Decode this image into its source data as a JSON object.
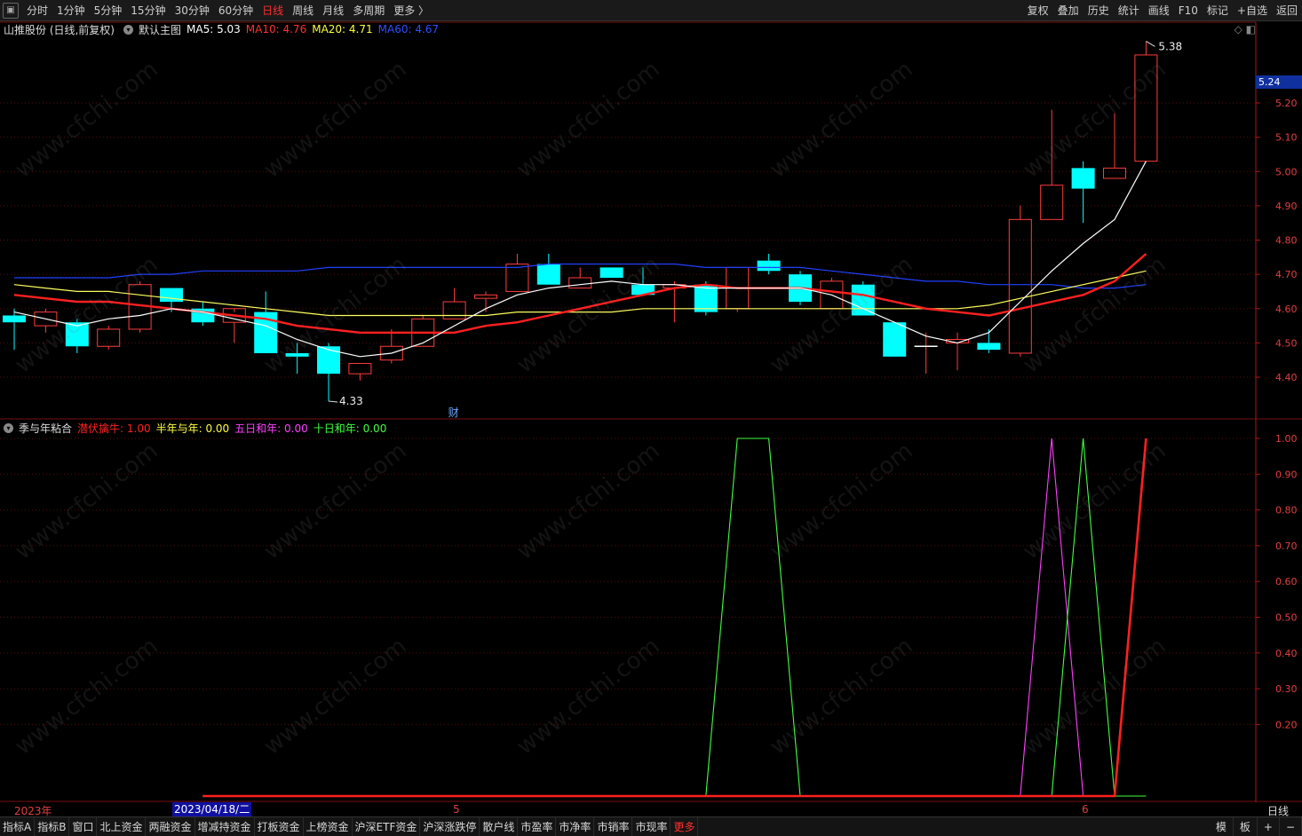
{
  "toolbar": {
    "periods": [
      "分时",
      "1分钟",
      "5分钟",
      "15分钟",
      "30分钟",
      "60分钟",
      "日线",
      "周线",
      "月线",
      "多周期",
      "更多 〉"
    ],
    "active_period": "日线",
    "right_buttons": [
      "复权",
      "叠加",
      "历史",
      "统计",
      "画线",
      "F10",
      "标记",
      "+自选",
      "返回"
    ]
  },
  "main_chart": {
    "stock": "山推股份 (日线,前复权)",
    "template": "默认主图",
    "ma5": "MA5: 5.03",
    "ma10": "MA10: 4.76",
    "ma20": "MA20: 4.71",
    "ma60": "MA60: 4.67",
    "current_price_tag": "5.24",
    "high_label": "5.38",
    "low_label": "4.33",
    "finance_marker": "财"
  },
  "sub_chart": {
    "name": "季与年粘合",
    "l1": "潜伏擒牛: 1.00",
    "l2": "半年与年: 0.00",
    "l3": "五日和年: 0.00",
    "l4": "十日和年: 0.00"
  },
  "date_axis": {
    "year": "2023年",
    "cursor": "2023/04/18/二",
    "m5": "5",
    "m6": "6",
    "period": "日线"
  },
  "bottom_tabs": [
    "指标A",
    "指标B",
    "窗口",
    "北上资金",
    "两融资金",
    "增减持资金",
    "打板资金",
    "上榜资金",
    "沪深ETF资金",
    "沪深涨跌停",
    "散户线",
    "市盈率",
    "市净率",
    "市销率",
    "市现率",
    "更多"
  ],
  "bottom_right": [
    "模",
    "板",
    "+",
    "−"
  ],
  "watermark": "www.cfchi.com",
  "colors": {
    "up": "#ff3c3c",
    "down": "#00ffff",
    "ma5": "#ffffff",
    "ma10": "#ff2020",
    "ma20": "#ffff60",
    "ma60": "#2040ff"
  },
  "chart_data": [
    {
      "type": "candlestick",
      "title": "山推股份 (日线,前复权)",
      "ylim": [
        4.33,
        5.38
      ],
      "y_ticks": [
        4.4,
        4.5,
        4.6,
        4.7,
        4.8,
        4.9,
        5.0,
        5.1,
        5.2
      ],
      "candles": [
        {
          "o": 4.58,
          "h": 4.6,
          "l": 4.48,
          "c": 4.56
        },
        {
          "o": 4.55,
          "h": 4.6,
          "l": 4.53,
          "c": 4.59
        },
        {
          "o": 4.56,
          "h": 4.57,
          "l": 4.47,
          "c": 4.49
        },
        {
          "o": 4.49,
          "h": 4.55,
          "l": 4.48,
          "c": 4.54
        },
        {
          "o": 4.54,
          "h": 4.68,
          "l": 4.53,
          "c": 4.67
        },
        {
          "o": 4.66,
          "h": 4.66,
          "l": 4.59,
          "c": 4.62
        },
        {
          "o": 4.6,
          "h": 4.62,
          "l": 4.55,
          "c": 4.56
        },
        {
          "o": 4.56,
          "h": 4.59,
          "l": 4.5,
          "c": 4.6
        },
        {
          "o": 4.59,
          "h": 4.65,
          "l": 4.47,
          "c": 4.47
        },
        {
          "o": 4.47,
          "h": 4.5,
          "l": 4.41,
          "c": 4.46
        },
        {
          "o": 4.49,
          "h": 4.5,
          "l": 4.33,
          "c": 4.41
        },
        {
          "o": 4.41,
          "h": 4.44,
          "l": 4.39,
          "c": 4.44
        },
        {
          "o": 4.45,
          "h": 4.54,
          "l": 4.44,
          "c": 4.49
        },
        {
          "o": 4.49,
          "h": 4.58,
          "l": 4.49,
          "c": 4.57
        },
        {
          "o": 4.57,
          "h": 4.66,
          "l": 4.57,
          "c": 4.62
        },
        {
          "o": 4.63,
          "h": 4.65,
          "l": 4.59,
          "c": 4.64
        },
        {
          "o": 4.65,
          "h": 4.76,
          "l": 4.65,
          "c": 4.73
        },
        {
          "o": 4.73,
          "h": 4.76,
          "l": 4.67,
          "c": 4.67
        },
        {
          "o": 4.66,
          "h": 4.72,
          "l": 4.66,
          "c": 4.69
        },
        {
          "o": 4.72,
          "h": 4.72,
          "l": 4.69,
          "c": 4.69
        },
        {
          "o": 4.67,
          "h": 4.72,
          "l": 4.64,
          "c": 4.64
        },
        {
          "o": 4.66,
          "h": 4.68,
          "l": 4.56,
          "c": 4.67
        },
        {
          "o": 4.67,
          "h": 4.68,
          "l": 4.58,
          "c": 4.59
        },
        {
          "o": 4.6,
          "h": 4.72,
          "l": 4.59,
          "c": 4.72
        },
        {
          "o": 4.74,
          "h": 4.76,
          "l": 4.7,
          "c": 4.71
        },
        {
          "o": 4.7,
          "h": 4.71,
          "l": 4.61,
          "c": 4.62
        },
        {
          "o": 4.6,
          "h": 4.69,
          "l": 4.6,
          "c": 4.68
        },
        {
          "o": 4.67,
          "h": 4.68,
          "l": 4.58,
          "c": 4.58
        },
        {
          "o": 4.56,
          "h": 4.56,
          "l": 4.46,
          "c": 4.46
        },
        {
          "o": 4.49,
          "h": 4.53,
          "l": 4.41,
          "c": 4.49
        },
        {
          "o": 4.5,
          "h": 4.53,
          "l": 4.42,
          "c": 4.51
        },
        {
          "o": 4.5,
          "h": 4.54,
          "l": 4.47,
          "c": 4.48
        },
        {
          "o": 4.47,
          "h": 4.9,
          "l": 4.46,
          "c": 4.86
        },
        {
          "o": 4.86,
          "h": 5.18,
          "l": 4.86,
          "c": 4.96
        },
        {
          "o": 5.01,
          "h": 5.03,
          "l": 4.85,
          "c": 4.95
        },
        {
          "o": 4.98,
          "h": 5.17,
          "l": 4.98,
          "c": 5.01
        },
        {
          "o": 5.03,
          "h": 5.38,
          "l": 5.03,
          "c": 5.34
        }
      ],
      "ma5": [
        4.59,
        4.57,
        4.55,
        4.57,
        4.58,
        4.6,
        4.59,
        4.57,
        4.55,
        4.51,
        4.48,
        4.46,
        4.47,
        4.5,
        4.55,
        4.6,
        4.64,
        4.66,
        4.67,
        4.68,
        4.67,
        4.67,
        4.66,
        4.66,
        4.66,
        4.66,
        4.64,
        4.6,
        4.56,
        4.52,
        4.5,
        4.53,
        4.62,
        4.71,
        4.79,
        4.86,
        5.03
      ],
      "ma10": [
        4.64,
        4.63,
        4.62,
        4.62,
        4.61,
        4.6,
        4.59,
        4.58,
        4.57,
        4.55,
        4.54,
        4.53,
        4.53,
        4.53,
        4.53,
        4.55,
        4.56,
        4.58,
        4.6,
        4.62,
        4.64,
        4.66,
        4.67,
        4.66,
        4.66,
        4.66,
        4.65,
        4.64,
        4.62,
        4.6,
        4.59,
        4.58,
        4.6,
        4.62,
        4.64,
        4.68,
        4.76
      ],
      "ma20": [
        4.67,
        4.66,
        4.65,
        4.65,
        4.64,
        4.63,
        4.62,
        4.61,
        4.6,
        4.59,
        4.58,
        4.58,
        4.58,
        4.58,
        4.58,
        4.58,
        4.59,
        4.59,
        4.59,
        4.59,
        4.6,
        4.6,
        4.6,
        4.6,
        4.6,
        4.6,
        4.6,
        4.6,
        4.6,
        4.6,
        4.6,
        4.61,
        4.63,
        4.65,
        4.67,
        4.69,
        4.71
      ],
      "ma60": [
        4.69,
        4.69,
        4.69,
        4.69,
        4.7,
        4.7,
        4.71,
        4.71,
        4.71,
        4.71,
        4.72,
        4.72,
        4.72,
        4.72,
        4.72,
        4.72,
        4.72,
        4.73,
        4.73,
        4.73,
        4.73,
        4.73,
        4.72,
        4.72,
        4.72,
        4.72,
        4.71,
        4.7,
        4.69,
        4.68,
        4.68,
        4.67,
        4.67,
        4.67,
        4.66,
        4.66,
        4.67
      ]
    },
    {
      "type": "line",
      "title": "季与年粘合",
      "ylim": [
        0,
        1.0
      ],
      "y_ticks": [
        0.2,
        0.3,
        0.4,
        0.5,
        0.6,
        0.7,
        0.8,
        0.9,
        1.0
      ],
      "series": [
        {
          "name": "潜伏擒牛",
          "color": "#ff2020",
          "values": [
            0,
            0,
            0,
            0,
            0,
            0,
            0,
            0,
            0,
            0,
            0,
            0,
            0,
            0,
            0,
            0,
            0,
            0,
            0,
            0,
            0,
            0,
            0,
            0,
            0,
            0,
            0,
            0,
            0,
            0,
            0,
            0,
            0,
            0,
            0,
            0,
            1
          ]
        },
        {
          "name": "半年与年",
          "color": "#ffff40",
          "values": [
            0,
            0,
            0,
            0,
            0,
            0,
            0,
            0,
            0,
            0,
            0,
            0,
            0,
            0,
            0,
            0,
            0,
            0,
            0,
            0,
            0,
            0,
            0,
            0,
            0,
            0,
            0,
            0,
            0,
            0,
            0,
            0,
            0,
            0,
            0,
            0,
            0
          ]
        },
        {
          "name": "五日和年",
          "color": "#ff40ff",
          "values": [
            0,
            0,
            0,
            0,
            0,
            0,
            0,
            0,
            0,
            0,
            0,
            0,
            0,
            0,
            0,
            0,
            0,
            0,
            0,
            0,
            0,
            0,
            0,
            0,
            0,
            0,
            0,
            0,
            0,
            0,
            0,
            0,
            0,
            1,
            0,
            0,
            0
          ]
        },
        {
          "name": "十日和年",
          "color": "#40ff40",
          "values": [
            0,
            0,
            0,
            0,
            0,
            0,
            0,
            0,
            0,
            0,
            0,
            0,
            0,
            0,
            0,
            0,
            0,
            0,
            0,
            0,
            0,
            0,
            0,
            1,
            1,
            0,
            0,
            0,
            0,
            0,
            0,
            0,
            0,
            0,
            1,
            0,
            0
          ]
        }
      ]
    }
  ]
}
